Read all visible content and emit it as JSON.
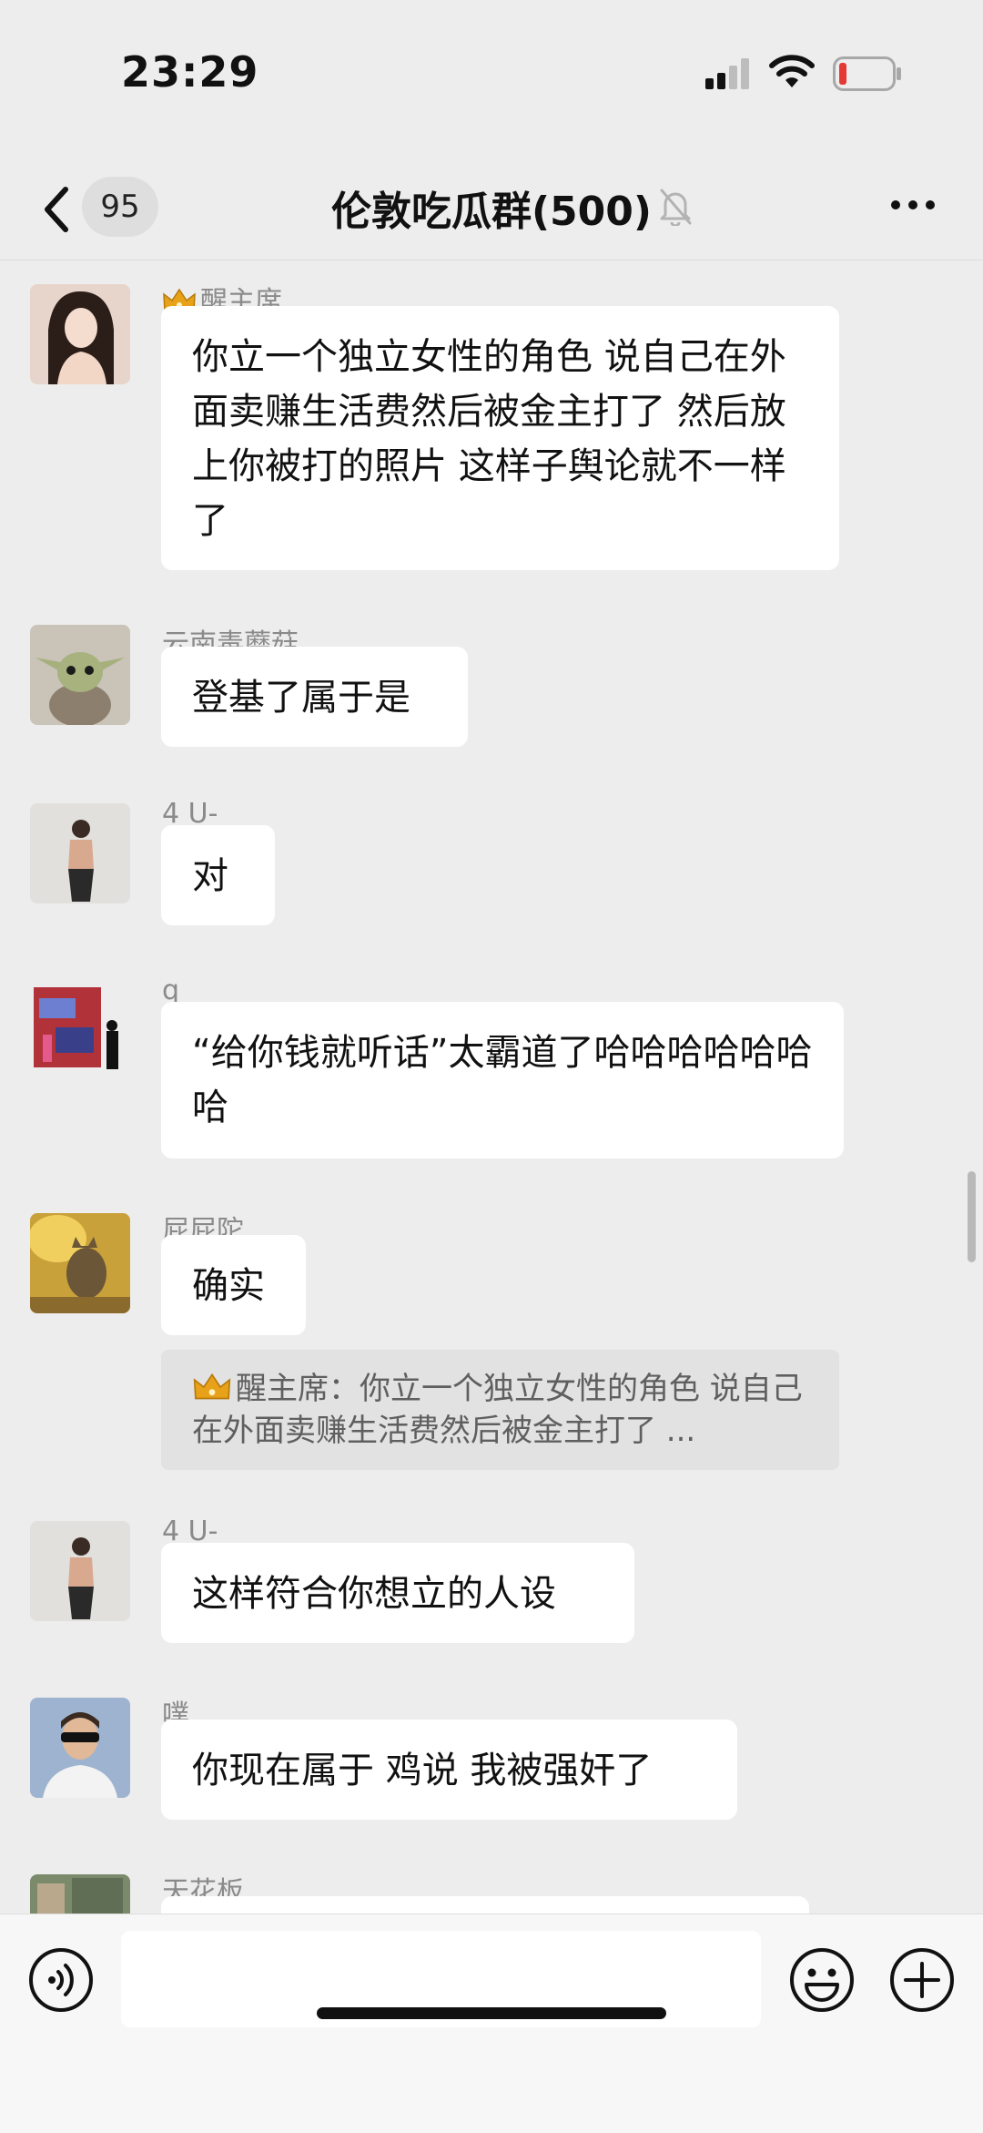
{
  "status": {
    "time": "23:29"
  },
  "header": {
    "back_count": "95",
    "title": "伦敦吃瓜群(500)"
  },
  "messages": [
    {
      "sender": "醒主席",
      "text": "你立一个独立女性的角色 说自己在外面卖赚生活费然后被金主打了 然后放上你被打的照片 这样子舆论就不一样了"
    },
    {
      "sender": "云南毒蘑菇",
      "text": "登基了属于是"
    },
    {
      "sender": "4 U-",
      "text": "对"
    },
    {
      "sender": "q",
      "text": "“给你钱就听话”太霸道了哈哈哈哈哈哈哈"
    },
    {
      "sender": "屁屁陀",
      "text": "确实",
      "quote": "醒主席：你立一个独立女性的角色 说自己在外面卖赚生活费然后被金主打了 ..."
    },
    {
      "sender": "4 U-",
      "text": "这样符合你想立的人设"
    },
    {
      "sender": "噗",
      "text": "你现在属于 鸡说 我被强奸了"
    },
    {
      "sender": "天花板",
      "text": ""
    }
  ],
  "colors": {
    "background": "#ededed",
    "bubble": "#ffffff",
    "quote": "#e2e2e2",
    "battery_low": "#e53935"
  }
}
